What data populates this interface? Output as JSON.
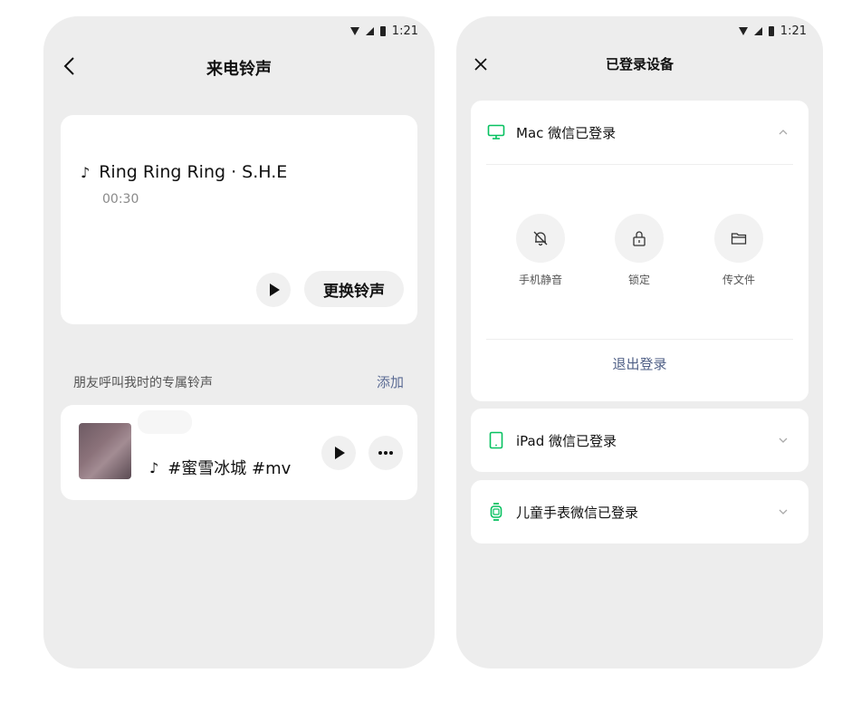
{
  "left": {
    "status": {
      "time": "1:21"
    },
    "title": "来电铃声",
    "ringtone": {
      "note": "♪",
      "name": "Ring Ring Ring · S.H.E",
      "duration": "00:30",
      "change_label": "更换铃声"
    },
    "friends": {
      "section_label": "朋友呼叫我时的专属铃声",
      "add_label": "添加",
      "items": [
        {
          "song": "#蜜雪冰城 #mv"
        }
      ]
    }
  },
  "right": {
    "status": {
      "time": "1:21"
    },
    "title": "已登录设备",
    "devices": [
      {
        "name": "Mac 微信已登录",
        "icon": "monitor-icon",
        "expanded": true
      },
      {
        "name": "iPad 微信已登录",
        "icon": "tablet-icon",
        "expanded": false
      },
      {
        "name": "儿童手表微信已登录",
        "icon": "watch-icon",
        "expanded": false
      }
    ],
    "actions": [
      {
        "label": "手机静音",
        "icon": "bell-off-icon"
      },
      {
        "label": "锁定",
        "icon": "lock-icon"
      },
      {
        "label": "传文件",
        "icon": "folder-icon"
      }
    ],
    "logout_label": "退出登录"
  },
  "colors": {
    "accent_green": "#07c160",
    "link_blue": "#5b6b94",
    "background": "#ededed"
  }
}
